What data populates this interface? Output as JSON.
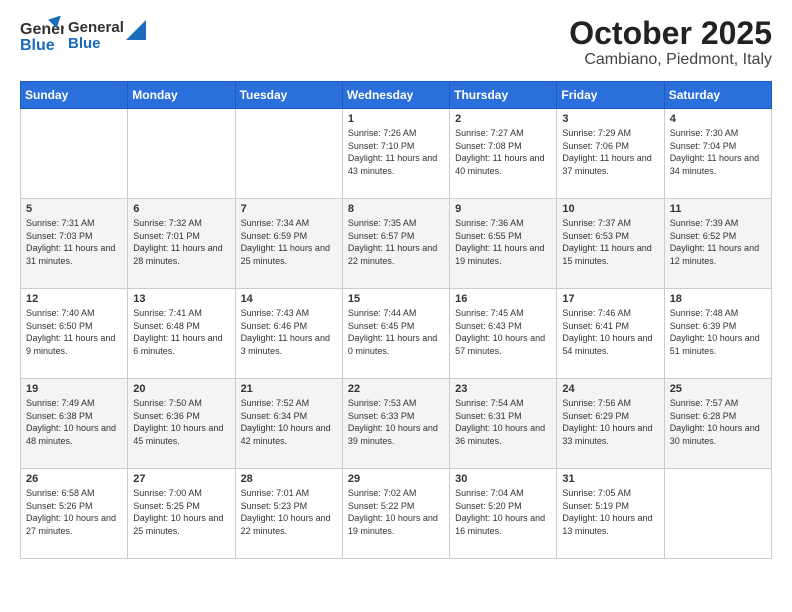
{
  "logo": {
    "general": "General",
    "blue": "Blue"
  },
  "title": "October 2025",
  "location": "Cambiano, Piedmont, Italy",
  "weekdays": [
    "Sunday",
    "Monday",
    "Tuesday",
    "Wednesday",
    "Thursday",
    "Friday",
    "Saturday"
  ],
  "weeks": [
    [
      {
        "day": "",
        "empty": true
      },
      {
        "day": "",
        "empty": true
      },
      {
        "day": "",
        "empty": true
      },
      {
        "day": "1",
        "sunrise": "7:26 AM",
        "sunset": "7:10 PM",
        "daylight": "11 hours and 43 minutes."
      },
      {
        "day": "2",
        "sunrise": "7:27 AM",
        "sunset": "7:08 PM",
        "daylight": "11 hours and 40 minutes."
      },
      {
        "day": "3",
        "sunrise": "7:29 AM",
        "sunset": "7:06 PM",
        "daylight": "11 hours and 37 minutes."
      },
      {
        "day": "4",
        "sunrise": "7:30 AM",
        "sunset": "7:04 PM",
        "daylight": "11 hours and 34 minutes."
      }
    ],
    [
      {
        "day": "5",
        "sunrise": "7:31 AM",
        "sunset": "7:03 PM",
        "daylight": "11 hours and 31 minutes."
      },
      {
        "day": "6",
        "sunrise": "7:32 AM",
        "sunset": "7:01 PM",
        "daylight": "11 hours and 28 minutes."
      },
      {
        "day": "7",
        "sunrise": "7:34 AM",
        "sunset": "6:59 PM",
        "daylight": "11 hours and 25 minutes."
      },
      {
        "day": "8",
        "sunrise": "7:35 AM",
        "sunset": "6:57 PM",
        "daylight": "11 hours and 22 minutes."
      },
      {
        "day": "9",
        "sunrise": "7:36 AM",
        "sunset": "6:55 PM",
        "daylight": "11 hours and 19 minutes."
      },
      {
        "day": "10",
        "sunrise": "7:37 AM",
        "sunset": "6:53 PM",
        "daylight": "11 hours and 15 minutes."
      },
      {
        "day": "11",
        "sunrise": "7:39 AM",
        "sunset": "6:52 PM",
        "daylight": "11 hours and 12 minutes."
      }
    ],
    [
      {
        "day": "12",
        "sunrise": "7:40 AM",
        "sunset": "6:50 PM",
        "daylight": "11 hours and 9 minutes."
      },
      {
        "day": "13",
        "sunrise": "7:41 AM",
        "sunset": "6:48 PM",
        "daylight": "11 hours and 6 minutes."
      },
      {
        "day": "14",
        "sunrise": "7:43 AM",
        "sunset": "6:46 PM",
        "daylight": "11 hours and 3 minutes."
      },
      {
        "day": "15",
        "sunrise": "7:44 AM",
        "sunset": "6:45 PM",
        "daylight": "11 hours and 0 minutes."
      },
      {
        "day": "16",
        "sunrise": "7:45 AM",
        "sunset": "6:43 PM",
        "daylight": "10 hours and 57 minutes."
      },
      {
        "day": "17",
        "sunrise": "7:46 AM",
        "sunset": "6:41 PM",
        "daylight": "10 hours and 54 minutes."
      },
      {
        "day": "18",
        "sunrise": "7:48 AM",
        "sunset": "6:39 PM",
        "daylight": "10 hours and 51 minutes."
      }
    ],
    [
      {
        "day": "19",
        "sunrise": "7:49 AM",
        "sunset": "6:38 PM",
        "daylight": "10 hours and 48 minutes."
      },
      {
        "day": "20",
        "sunrise": "7:50 AM",
        "sunset": "6:36 PM",
        "daylight": "10 hours and 45 minutes."
      },
      {
        "day": "21",
        "sunrise": "7:52 AM",
        "sunset": "6:34 PM",
        "daylight": "10 hours and 42 minutes."
      },
      {
        "day": "22",
        "sunrise": "7:53 AM",
        "sunset": "6:33 PM",
        "daylight": "10 hours and 39 minutes."
      },
      {
        "day": "23",
        "sunrise": "7:54 AM",
        "sunset": "6:31 PM",
        "daylight": "10 hours and 36 minutes."
      },
      {
        "day": "24",
        "sunrise": "7:56 AM",
        "sunset": "6:29 PM",
        "daylight": "10 hours and 33 minutes."
      },
      {
        "day": "25",
        "sunrise": "7:57 AM",
        "sunset": "6:28 PM",
        "daylight": "10 hours and 30 minutes."
      }
    ],
    [
      {
        "day": "26",
        "sunrise": "6:58 AM",
        "sunset": "5:26 PM",
        "daylight": "10 hours and 27 minutes."
      },
      {
        "day": "27",
        "sunrise": "7:00 AM",
        "sunset": "5:25 PM",
        "daylight": "10 hours and 25 minutes."
      },
      {
        "day": "28",
        "sunrise": "7:01 AM",
        "sunset": "5:23 PM",
        "daylight": "10 hours and 22 minutes."
      },
      {
        "day": "29",
        "sunrise": "7:02 AM",
        "sunset": "5:22 PM",
        "daylight": "10 hours and 19 minutes."
      },
      {
        "day": "30",
        "sunrise": "7:04 AM",
        "sunset": "5:20 PM",
        "daylight": "10 hours and 16 minutes."
      },
      {
        "day": "31",
        "sunrise": "7:05 AM",
        "sunset": "5:19 PM",
        "daylight": "10 hours and 13 minutes."
      },
      {
        "day": "",
        "empty": true
      }
    ]
  ]
}
